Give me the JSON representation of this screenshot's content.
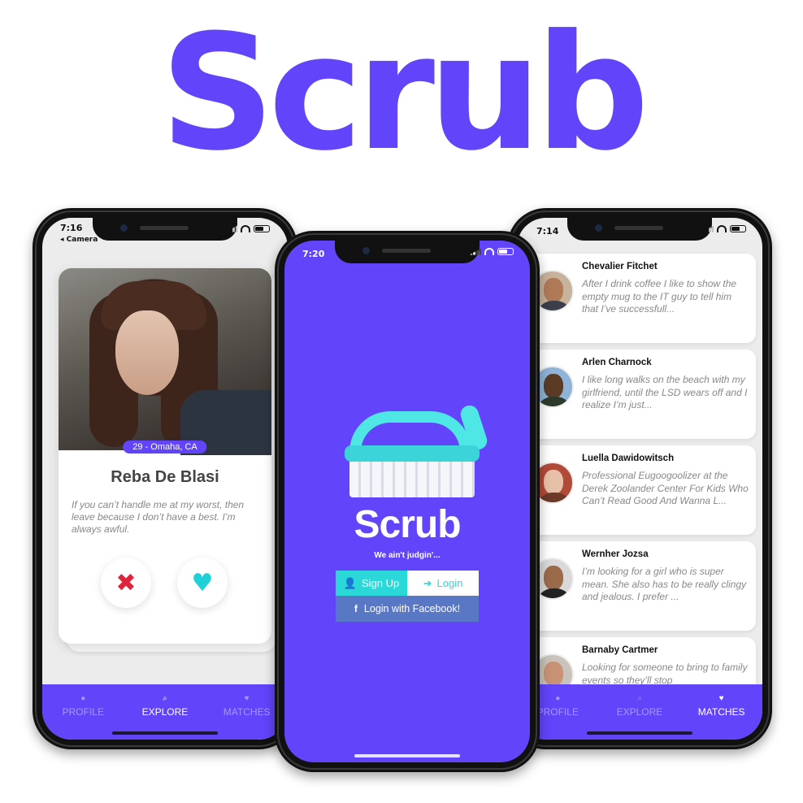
{
  "brand": {
    "title": "Scrub",
    "color": "#6244fb"
  },
  "left_phone": {
    "status_time": "7:16",
    "back_label": "◂ Camera",
    "profile": {
      "location": "29 - Omaha, CA",
      "name": "Reba De Blasi",
      "bio": "If you can’t handle me at my worst, then leave because I don’t have a best. I’m always awful."
    },
    "actions": {
      "nope_icon": "close-x-icon",
      "like_icon": "heart-icon"
    },
    "tabs": [
      {
        "label": "PROFILE",
        "icon": "user-icon",
        "active": false
      },
      {
        "label": "EXPLORE",
        "icon": "search-icon",
        "active": true
      },
      {
        "label": "MATCHES",
        "icon": "heart-icon",
        "active": false
      }
    ]
  },
  "center_phone": {
    "status_time": "7:20",
    "app_name": "Scrub",
    "tagline": "We ain't judgin'...",
    "signup_label": "Sign Up",
    "login_label": "Login",
    "facebook_label": "Login with Facebook!",
    "colors": {
      "background": "#6244fb",
      "signup": "#2ad8d8",
      "facebook": "#5877c4"
    }
  },
  "right_phone": {
    "status_time": "7:14",
    "matches": [
      {
        "name": "Chevalier Fitchet",
        "message": "After I drink coffee I like to show the empty mug to the IT guy to tell him that I’ve successfull..."
      },
      {
        "name": "Arlen Charnock",
        "message": "I like long walks on the beach with my girlfriend, until the LSD wears off and I realize I’m just..."
      },
      {
        "name": "Luella Dawidowitsch",
        "message": "Professional Eugoogoolizer at the Derek Zoolander Center For Kids Who Can’t Read Good And Wanna L..."
      },
      {
        "name": "Wernher Jozsa",
        "message": "I’m looking for a girl who is super mean. She also has to be really clingy and jealous. I prefer ..."
      },
      {
        "name": "Barnaby Cartmer",
        "message": "Looking for someone to bring to family events so they’ll stop"
      }
    ],
    "tabs": [
      {
        "label": "PROFILE",
        "icon": "user-icon",
        "active": false
      },
      {
        "label": "EXPLORE",
        "icon": "search-icon",
        "active": false
      },
      {
        "label": "MATCHES",
        "icon": "heart-icon",
        "active": true
      }
    ]
  }
}
